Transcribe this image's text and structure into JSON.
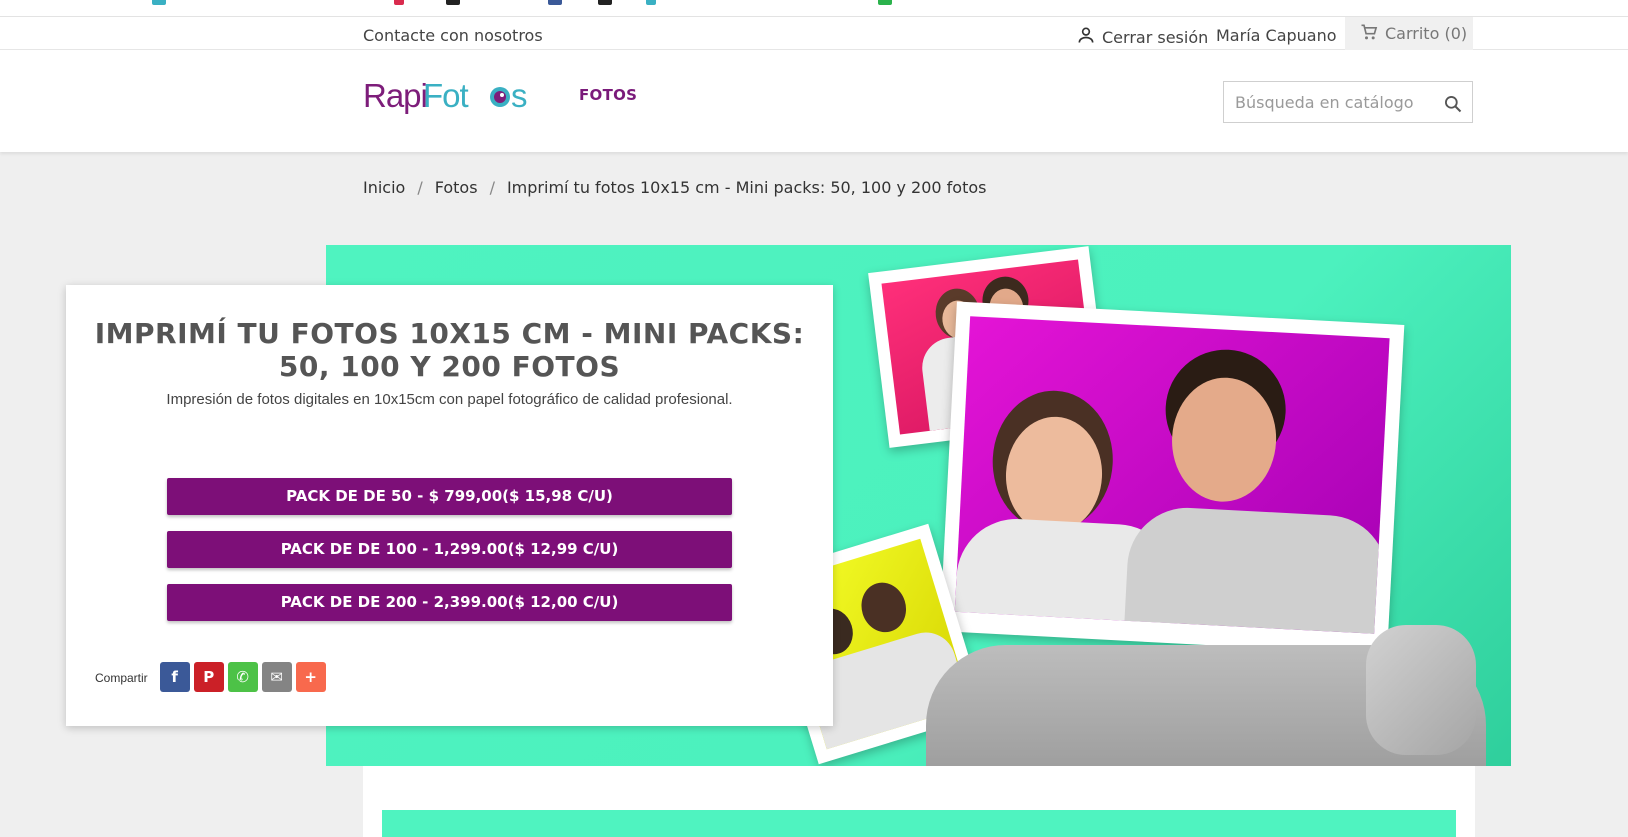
{
  "topbar": {
    "contact_label": "Contacte con nosotros",
    "logout_label": "Cerrar sesión",
    "user_name": "María Capuano",
    "cart_label": "Carrito (0)"
  },
  "header": {
    "logo_text_rapi": "Rapi",
    "logo_text_fotos": "Fotos",
    "nav": [
      {
        "label": "FOTOS"
      }
    ],
    "search_placeholder": "Búsqueda en catálogo"
  },
  "breadcrumb": [
    {
      "label": "Inicio"
    },
    {
      "label": "Fotos"
    },
    {
      "label": "Imprimí tu fotos 10x15 cm - Mini packs: 50, 100 y 200 fotos"
    }
  ],
  "product": {
    "title": "IMPRIMÍ TU FOTOS 10X15 CM - MINI PACKS: 50, 100 Y 200 FOTOS",
    "subtitle": "Impresión de fotos digitales en 10x15cm con papel fotográfico de calidad profesional.",
    "packs": [
      {
        "label": "PACK DE DE 50 - $ 799,00($ 15,98 C/U)"
      },
      {
        "label": "PACK DE DE 100 - 1,299.00($ 12,99 C/U)"
      },
      {
        "label": "PACK DE DE 200 - 2,399.00($ 12,00 C/U)"
      }
    ],
    "share_label": "Compartir",
    "share_buttons": [
      {
        "name": "facebook-icon",
        "glyph": "f",
        "color": "#3b5998"
      },
      {
        "name": "pinterest-icon",
        "glyph": "P",
        "color": "#cb2027"
      },
      {
        "name": "whatsapp-icon",
        "glyph": "✆",
        "color": "#4dc247"
      },
      {
        "name": "email-icon",
        "glyph": "✉",
        "color": "#848484"
      },
      {
        "name": "more-icon",
        "glyph": "+",
        "color": "#f8694d"
      }
    ]
  },
  "colors": {
    "brand_purple": "#7d0f78",
    "brand_teal": "#3ab0c3",
    "hero_green": "#4ff3c0"
  }
}
